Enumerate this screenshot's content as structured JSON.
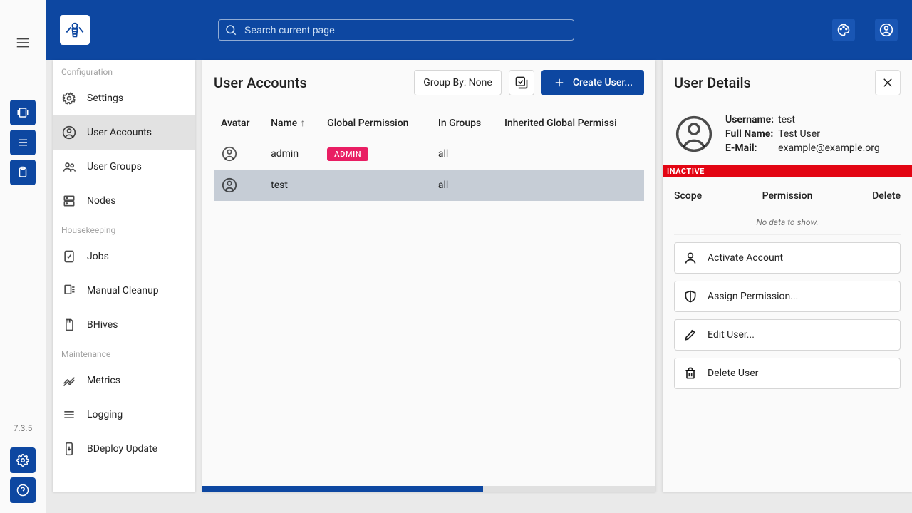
{
  "version": "7.3.5",
  "header": {
    "search_placeholder": "Search current page"
  },
  "sidenav": {
    "sections": [
      {
        "label": "Configuration",
        "items": [
          {
            "label": "Settings",
            "icon": "gear"
          },
          {
            "label": "User Accounts",
            "icon": "account",
            "active": true
          },
          {
            "label": "User Groups",
            "icon": "group"
          },
          {
            "label": "Nodes",
            "icon": "dns"
          }
        ]
      },
      {
        "label": "Housekeeping",
        "items": [
          {
            "label": "Jobs",
            "icon": "task"
          },
          {
            "label": "Manual Cleanup",
            "icon": "sweep"
          },
          {
            "label": "BHives",
            "icon": "sd"
          }
        ]
      },
      {
        "label": "Maintenance",
        "items": [
          {
            "label": "Metrics",
            "icon": "chart"
          },
          {
            "label": "Logging",
            "icon": "list"
          },
          {
            "label": "BDeploy Update",
            "icon": "update"
          }
        ]
      }
    ]
  },
  "accounts": {
    "title": "User Accounts",
    "group_by_label": "Group By: None",
    "create_label": "Create User...",
    "columns": [
      "Avatar",
      "Name",
      "Global Permission",
      "In Groups",
      "Inherited Global Permissi"
    ],
    "rows": [
      {
        "name": "admin",
        "perm": "ADMIN",
        "in_groups": "all",
        "selected": false
      },
      {
        "name": "test",
        "perm": "",
        "in_groups": "all",
        "selected": true
      }
    ]
  },
  "detail": {
    "title": "User Details",
    "fields": {
      "username_label": "Username:",
      "username": "test",
      "fullname_label": "Full Name:",
      "fullname": "Test User",
      "email_label": "E-Mail:",
      "email": "example@example.org"
    },
    "inactive_label": "INACTIVE",
    "perm_headers": {
      "scope": "Scope",
      "permission": "Permission",
      "delete": "Delete"
    },
    "no_data": "No data to show.",
    "actions": {
      "activate": "Activate Account",
      "assign": "Assign Permission...",
      "edit": "Edit User...",
      "delete": "Delete User"
    }
  }
}
